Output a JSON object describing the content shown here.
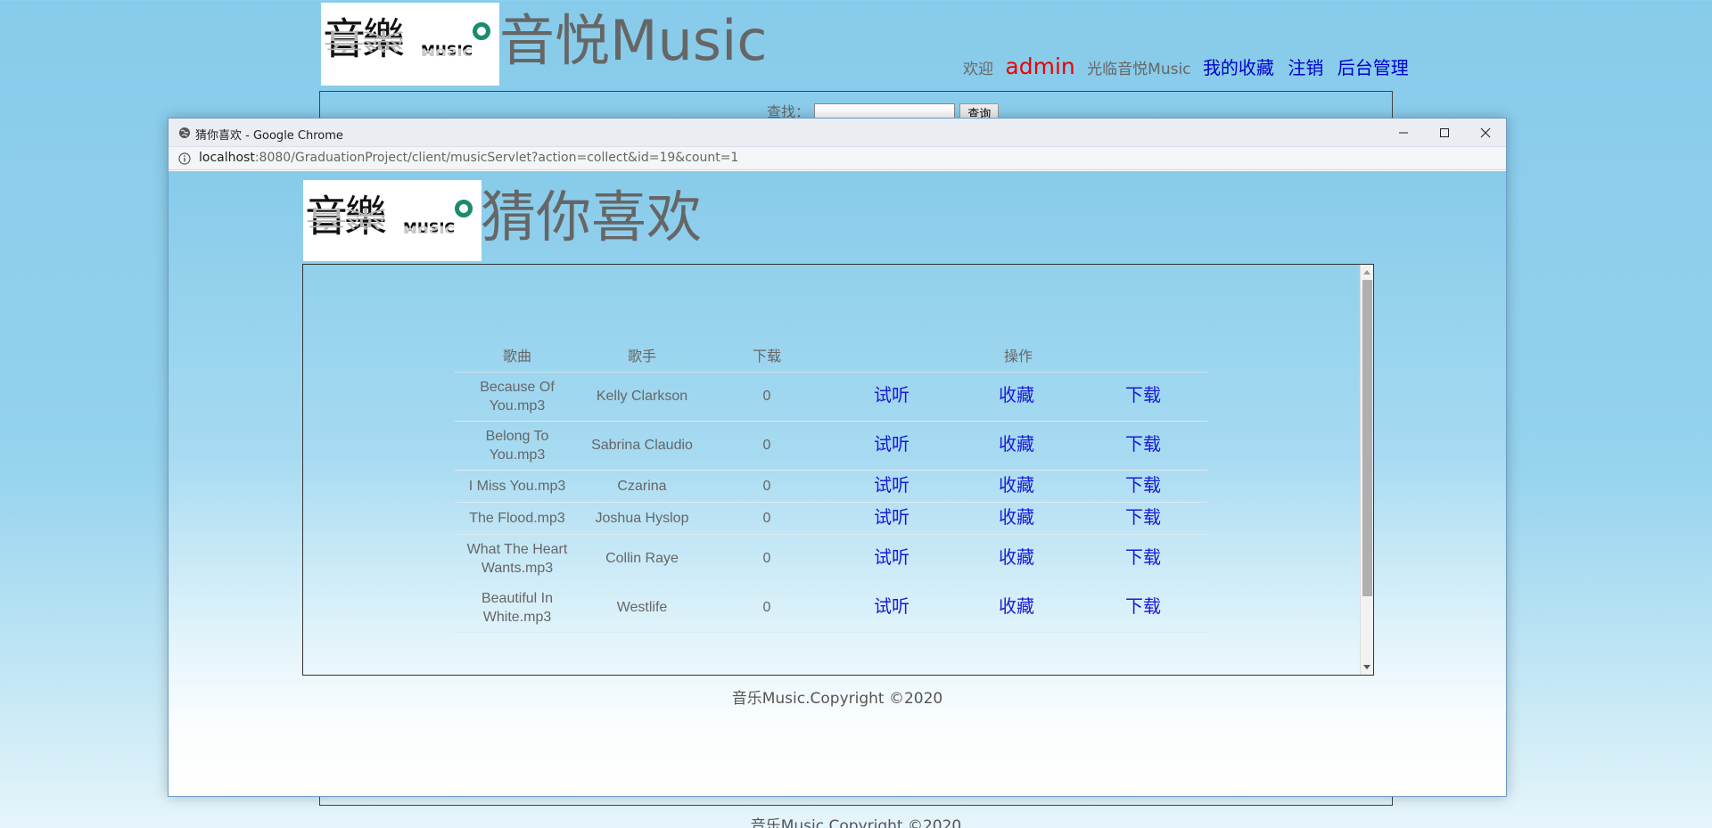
{
  "background_page": {
    "logo": {
      "cn": "音樂",
      "en": "MUSIC"
    },
    "title": "音悦Music",
    "nav": {
      "welcome": "欢迎",
      "user": "admin",
      "greeting": "光临音悦Music",
      "links": [
        "我的收藏",
        "注销",
        "后台管理"
      ]
    },
    "search": {
      "label": "查找：",
      "value": "",
      "button": "查询"
    },
    "footer": "音乐Music.Copyright ©2020"
  },
  "popup": {
    "window_title": "猜你喜欢 - Google Chrome",
    "address": {
      "host": "localhost",
      "rest": ":8080/GraduationProject/client/musicServlet?action=collect&id=19&count=1"
    },
    "logo": {
      "cn": "音樂",
      "en": "MUSIC"
    },
    "title": "猜你喜欢",
    "table": {
      "headers": [
        "歌曲",
        "歌手",
        "下载",
        "操作"
      ],
      "actions": [
        "试听",
        "收藏",
        "下载"
      ],
      "rows": [
        {
          "song": "Because Of You.mp3",
          "artist": "Kelly Clarkson",
          "downloads": "0"
        },
        {
          "song": "Belong To You.mp3",
          "artist": "Sabrina Claudio",
          "downloads": "0"
        },
        {
          "song": "I Miss You.mp3",
          "artist": "Czarina",
          "downloads": "0"
        },
        {
          "song": "The Flood.mp3",
          "artist": "Joshua Hyslop",
          "downloads": "0"
        },
        {
          "song": "What The Heart Wants.mp3",
          "artist": "Collin Raye",
          "downloads": "0"
        },
        {
          "song": "Beautiful In White.mp3",
          "artist": "Westlife",
          "downloads": "0"
        }
      ]
    },
    "footer": "音乐Music.Copyright ©2020"
  },
  "colors": {
    "accent_link": "#1a1ad6",
    "user_name": "#ee0000",
    "background": "#87cbea"
  }
}
